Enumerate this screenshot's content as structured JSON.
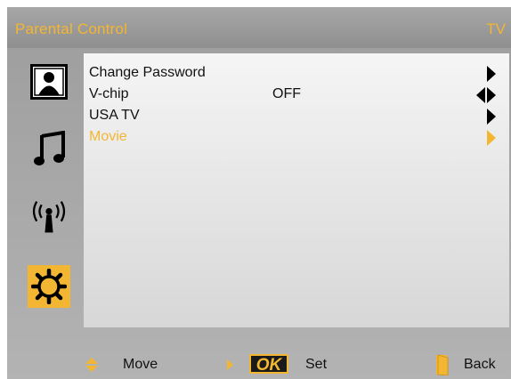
{
  "header": {
    "title": "Parental Control",
    "source": "TV"
  },
  "sidebar": {
    "items": [
      {
        "name": "picture",
        "icon": "person-portrait-icon"
      },
      {
        "name": "sound",
        "icon": "music-note-icon"
      },
      {
        "name": "channel",
        "icon": "antenna-signal-icon"
      },
      {
        "name": "setup",
        "icon": "gear-icon",
        "active": true
      }
    ]
  },
  "menu": {
    "items": [
      {
        "label": "Change Password",
        "value": "",
        "arrows": "right"
      },
      {
        "label": "V-chip",
        "value": "OFF",
        "arrows": "left-right"
      },
      {
        "label": "USA TV",
        "value": "",
        "arrows": "right"
      },
      {
        "label": "Movie",
        "value": "",
        "arrows": "right",
        "selected": true
      }
    ]
  },
  "footer": {
    "move_label": "Move",
    "ok_label": "OK",
    "set_label": "Set",
    "back_label": "Back"
  },
  "colors": {
    "accent": "#f3b632",
    "panel": "#eeeeee",
    "background": "#a9a9a9"
  }
}
